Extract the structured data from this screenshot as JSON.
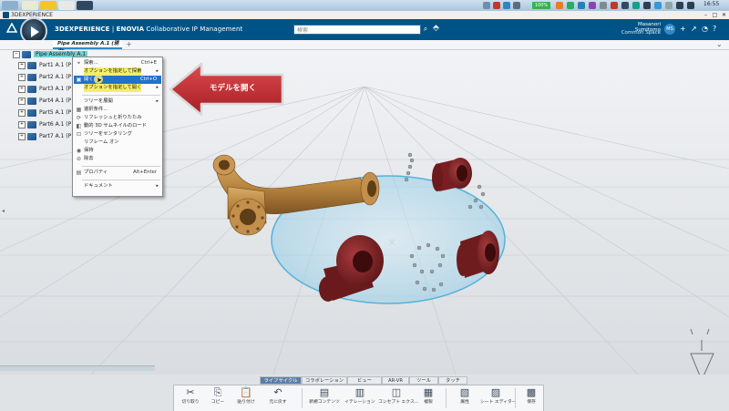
{
  "taskbar": {
    "battery": "100%",
    "clock": "16:55"
  },
  "titlebar": {
    "title": "3DEXPERIENCE",
    "minimize": "–",
    "maximize": "□",
    "close": "✕"
  },
  "header": {
    "brand": "3DEXPERIENCE",
    "app_sep": " | ",
    "app_name": "ENOVIA",
    "app_subtitle": " Collaborative IP Management",
    "search_placeholder": "検索",
    "user_name": "Masanori Sumitomo",
    "user_space": "Common Space",
    "avatar_initials": "MS"
  },
  "tabs": {
    "active": "Pipe Assembly A.1 (現実)",
    "add": "+"
  },
  "tree": {
    "root": "Pipe Assembly A.1",
    "parts": [
      "Part1 A.1 (P",
      "Part2 A.1 (P",
      "Part3 A.1 (P",
      "Part4 A.1 (P",
      "Part5 A.1 (P",
      "Part6 A.1 (P",
      "Part7 A.1 (P"
    ]
  },
  "context_menu": {
    "items": [
      {
        "label": "探索...",
        "shortcut": "Ctrl+E"
      },
      {
        "label": "オプションを指定して探索",
        "shortcut": "▸"
      },
      {
        "label": "開く",
        "shortcut": "Ctrl+O"
      },
      {
        "label": "オプションを指定して開く",
        "shortcut": "▸"
      },
      {
        "label": "ツリーを展開",
        "shortcut": "▸"
      },
      {
        "label": "選択条件...",
        "shortcut": ""
      },
      {
        "label": "リフレッシュと折りたたみ",
        "shortcut": ""
      },
      {
        "label": "動的 3D サムネイルのロード",
        "shortcut": ""
      },
      {
        "label": "ツリーをセンタリング",
        "shortcut": ""
      },
      {
        "label": "リフレーム オン",
        "shortcut": ""
      },
      {
        "label": "保持",
        "shortcut": ""
      },
      {
        "label": "除去",
        "shortcut": ""
      },
      {
        "label": "プロパティ",
        "shortcut": "Alt+Enter"
      },
      {
        "label": "ドキュメント",
        "shortcut": "▸"
      }
    ]
  },
  "callout": {
    "text": "モデルを開く"
  },
  "action_tabs": [
    "ライフサイクル",
    "コラボレーション",
    "ビュー",
    "AR-VR",
    "ツール",
    "タッチ"
  ],
  "action_bar": [
    {
      "icon": "✂",
      "label": "切り取り"
    },
    {
      "icon": "⎘",
      "label": "コピー"
    },
    {
      "icon": "📋",
      "label": "貼り付け"
    },
    {
      "icon": "↶",
      "label": "元に戻す"
    },
    {
      "icon": "▤",
      "label": "新規コンテンツ"
    },
    {
      "icon": "▥",
      "label": "イテレーション"
    },
    {
      "icon": "◫",
      "label": "コンセプト エクス..."
    },
    {
      "icon": "▦",
      "label": "複製"
    },
    {
      "icon": "▧",
      "label": "属性"
    },
    {
      "icon": "▨",
      "label": "シート エディター"
    },
    {
      "icon": "▩",
      "label": "保存"
    }
  ],
  "colors": {
    "header_blue": "#005386",
    "menu_highlight": "#1f73c9",
    "callout_red": "#c0282d",
    "pipe": "#b8853f",
    "flange": "#7a1e21",
    "disk": "#9fd3ea"
  }
}
